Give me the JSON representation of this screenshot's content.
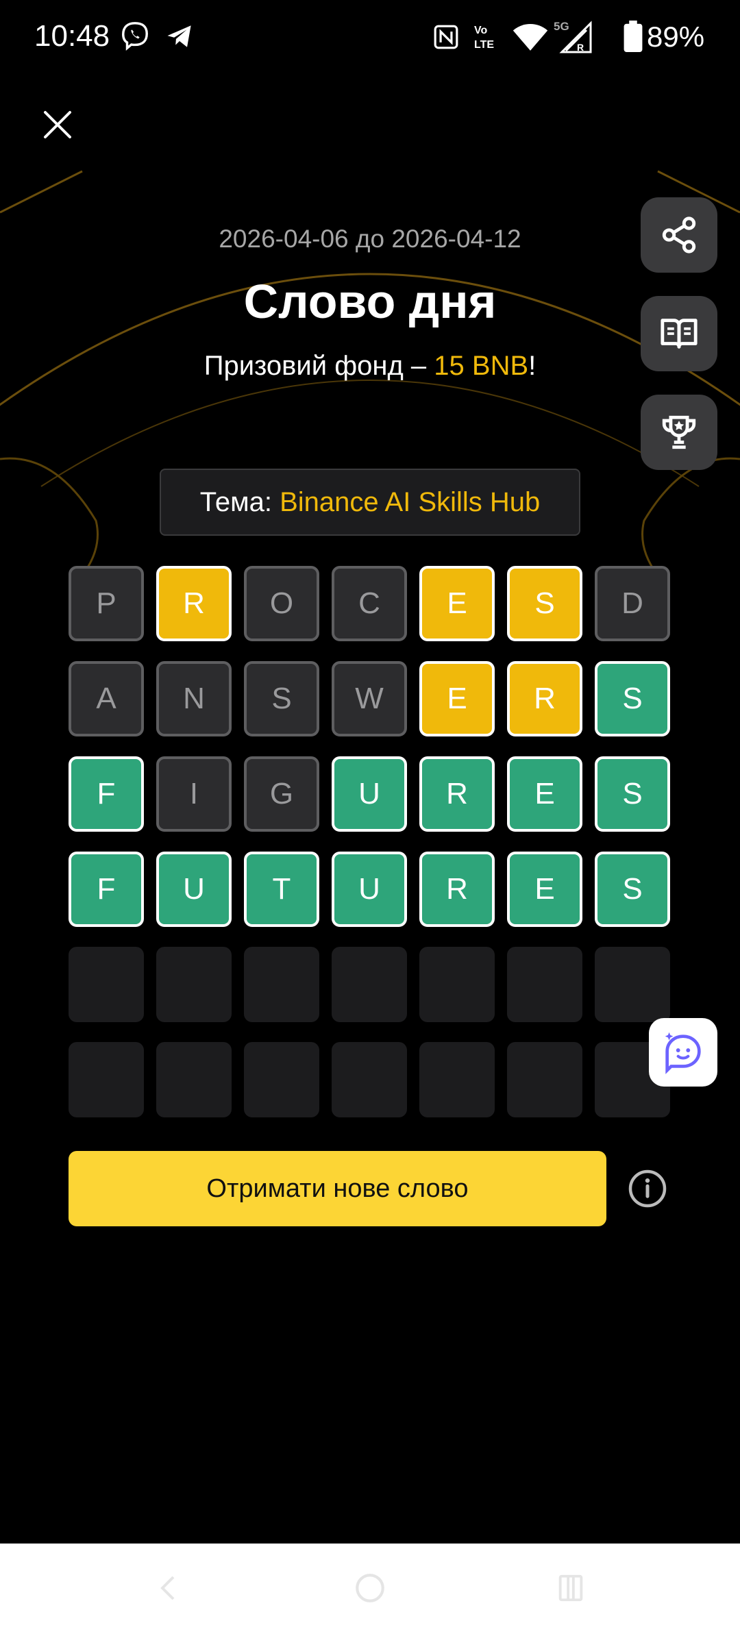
{
  "status_bar": {
    "time": "10:48",
    "battery": "89%",
    "icons": [
      "viber-icon",
      "telegram-icon",
      "nfc-icon",
      "volte-icon",
      "wifi-icon",
      "signal-5g-icon",
      "battery-icon"
    ]
  },
  "header": {
    "date_range": "2026-04-06 до 2026-04-12",
    "title": "Слово дня",
    "prize_prefix": "Призовий фонд – ",
    "prize_amount": "15 BNB",
    "prize_suffix": "!"
  },
  "theme": {
    "label": "Тема: ",
    "value": "Binance AI Skills Hub"
  },
  "side_buttons": [
    "share-icon",
    "book-icon",
    "trophy-icon"
  ],
  "board": {
    "rows": [
      [
        {
          "l": "P",
          "s": "absent"
        },
        {
          "l": "R",
          "s": "present"
        },
        {
          "l": "O",
          "s": "absent"
        },
        {
          "l": "C",
          "s": "absent"
        },
        {
          "l": "E",
          "s": "present"
        },
        {
          "l": "S",
          "s": "present"
        },
        {
          "l": "D",
          "s": "absent"
        }
      ],
      [
        {
          "l": "A",
          "s": "absent"
        },
        {
          "l": "N",
          "s": "absent"
        },
        {
          "l": "S",
          "s": "absent"
        },
        {
          "l": "W",
          "s": "absent"
        },
        {
          "l": "E",
          "s": "present"
        },
        {
          "l": "R",
          "s": "present"
        },
        {
          "l": "S",
          "s": "correct"
        }
      ],
      [
        {
          "l": "F",
          "s": "correct"
        },
        {
          "l": "I",
          "s": "absent"
        },
        {
          "l": "G",
          "s": "absent"
        },
        {
          "l": "U",
          "s": "correct"
        },
        {
          "l": "R",
          "s": "correct"
        },
        {
          "l": "E",
          "s": "correct"
        },
        {
          "l": "S",
          "s": "correct"
        }
      ],
      [
        {
          "l": "F",
          "s": "correct"
        },
        {
          "l": "U",
          "s": "correct"
        },
        {
          "l": "T",
          "s": "correct"
        },
        {
          "l": "U",
          "s": "correct"
        },
        {
          "l": "R",
          "s": "correct"
        },
        {
          "l": "E",
          "s": "correct"
        },
        {
          "l": "S",
          "s": "correct"
        }
      ],
      [
        {
          "l": "",
          "s": "empty"
        },
        {
          "l": "",
          "s": "empty"
        },
        {
          "l": "",
          "s": "empty"
        },
        {
          "l": "",
          "s": "empty"
        },
        {
          "l": "",
          "s": "empty"
        },
        {
          "l": "",
          "s": "empty"
        },
        {
          "l": "",
          "s": "empty"
        }
      ],
      [
        {
          "l": "",
          "s": "empty"
        },
        {
          "l": "",
          "s": "empty"
        },
        {
          "l": "",
          "s": "empty"
        },
        {
          "l": "",
          "s": "empty"
        },
        {
          "l": "",
          "s": "empty"
        },
        {
          "l": "",
          "s": "empty"
        },
        {
          "l": "",
          "s": "empty"
        }
      ]
    ]
  },
  "actions": {
    "new_word_label": "Отримати нове слово"
  },
  "colors": {
    "accent_yellow": "#f0b90b",
    "button_yellow": "#fcd535",
    "correct_green": "#2ea57a",
    "absent_gray": "#2c2c2e"
  }
}
